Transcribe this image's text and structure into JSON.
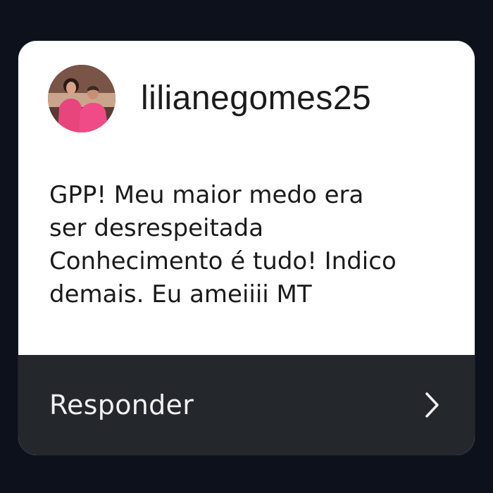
{
  "comment": {
    "username": "lilianegomes25",
    "avatar_icon": "profile-photo-icon",
    "message_lines": [
      "GPP! Meu maior medo era",
      "ser desrespeitada",
      "Conhecimento é tudo! Indico",
      "demais. Eu ameiiii MT"
    ]
  },
  "reply": {
    "label": "Responder",
    "icon": "chevron-right-icon"
  },
  "colors": {
    "background": "#0c111b",
    "card": "#ffffff",
    "reply_bar": "#24272c",
    "text_dark": "#1a1a1a",
    "text_light": "#f2f2f2"
  }
}
